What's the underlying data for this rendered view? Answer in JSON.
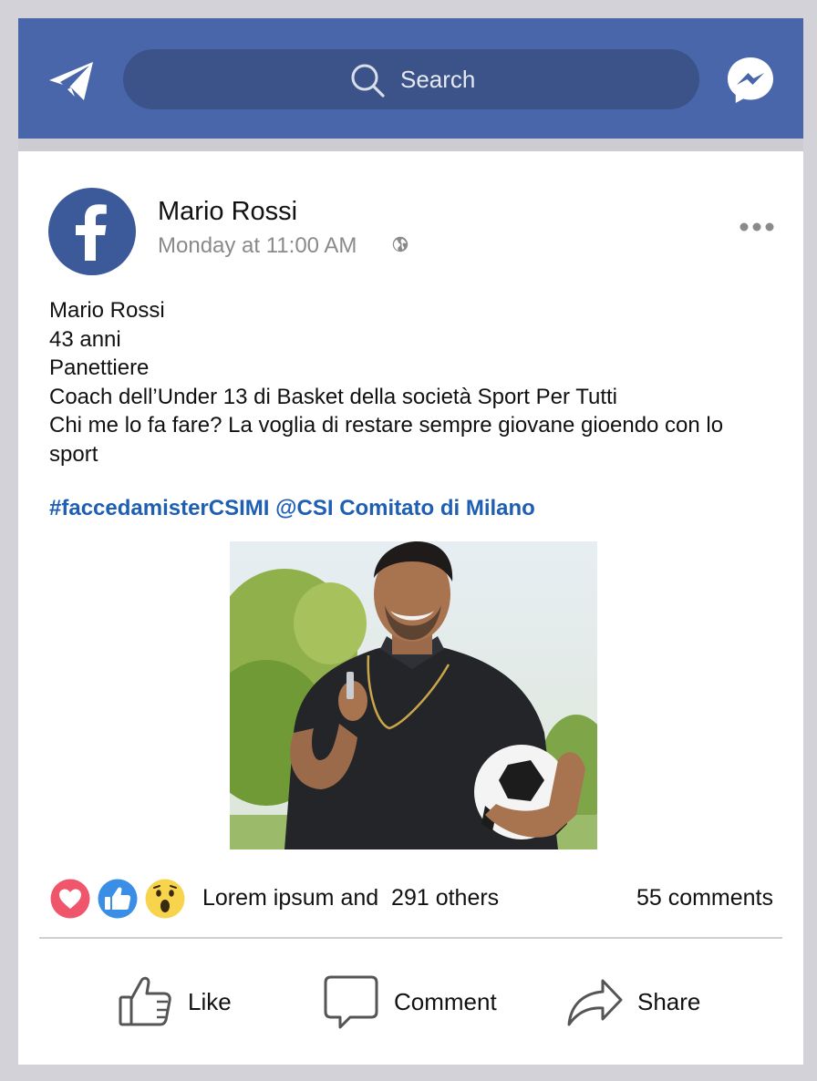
{
  "header": {
    "search_placeholder": "Search",
    "brand_color": "#4a66ab",
    "search_color": "#3b5389",
    "icons": [
      "paper-plane-icon",
      "search-icon",
      "messenger-icon"
    ]
  },
  "post": {
    "author": "Mario Rossi",
    "timestamp": "Monday at 11:00 AM",
    "body_lines": [
      "Mario Rossi",
      "43 anni",
      "Panettiere",
      "Coach dell’Under 13 di Basket della società Sport Per Tutti",
      "Chi me lo fa fare? La voglia di restare sempre giovane gioendo con lo",
      "sport"
    ],
    "tags": "#faccedamisterCSIMI @CSI Comitato di Milano",
    "tag_color": "#1e5fb3"
  },
  "reactions": {
    "icons": [
      "heart-icon",
      "thumbs-up-icon",
      "wow-icon"
    ],
    "summary": "Lorem ipsum and  291 others",
    "comments": "55 comments"
  },
  "actions": {
    "like": "Like",
    "comment": "Comment",
    "share": "Share"
  }
}
